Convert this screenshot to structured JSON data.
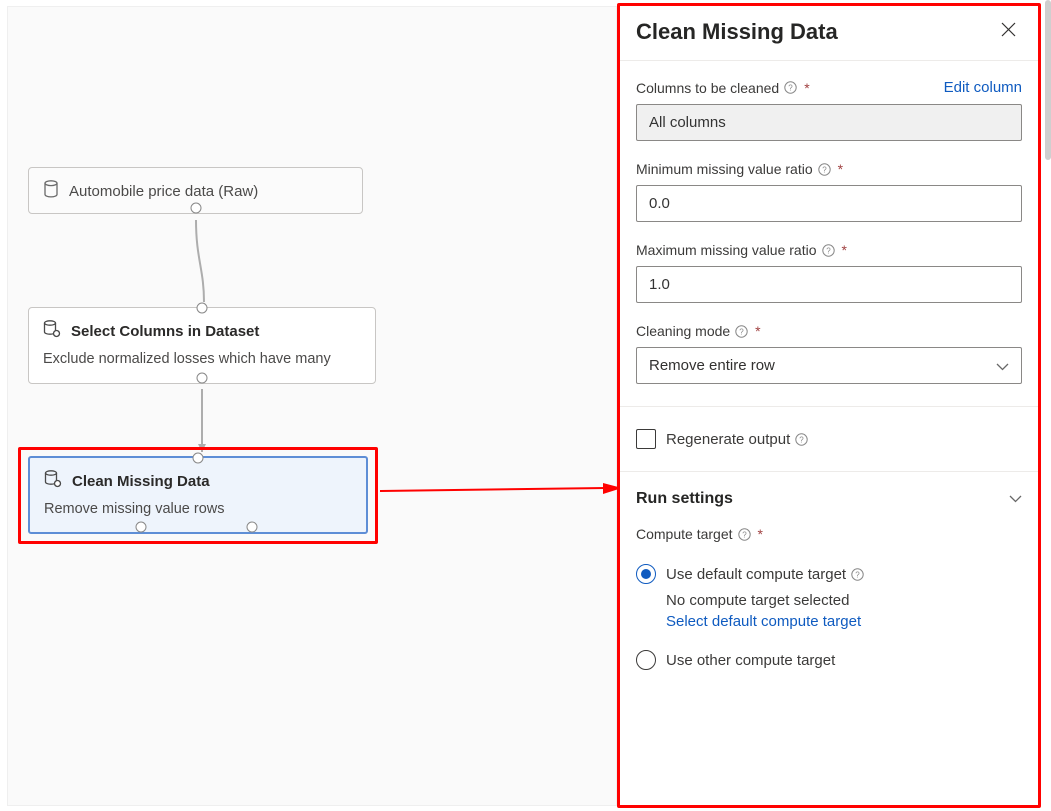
{
  "canvas": {
    "node1": {
      "title": "Automobile price data (Raw)"
    },
    "node2": {
      "title": "Select Columns in Dataset",
      "sub": "Exclude normalized losses which have many"
    },
    "node3": {
      "title": "Clean Missing Data",
      "sub": "Remove missing value rows"
    }
  },
  "panel": {
    "title": "Clean Missing Data",
    "columns_label": "Columns to be cleaned",
    "edit_column": "Edit column",
    "columns_value": "All columns",
    "min_label": "Minimum missing value ratio",
    "min_value": "0.0",
    "max_label": "Maximum missing value ratio",
    "max_value": "1.0",
    "mode_label": "Cleaning mode",
    "mode_value": "Remove entire row",
    "regen_label": "Regenerate output",
    "run_title": "Run settings",
    "compute_label": "Compute target",
    "radio1_label": "Use default compute target",
    "radio1_note": "No compute target selected",
    "radio1_link": "Select default compute target",
    "radio2_label": "Use other compute target"
  },
  "colors": {
    "highlight": "#ff0100",
    "link": "#0f5bc0",
    "selected_border": "#5e8ed6"
  }
}
